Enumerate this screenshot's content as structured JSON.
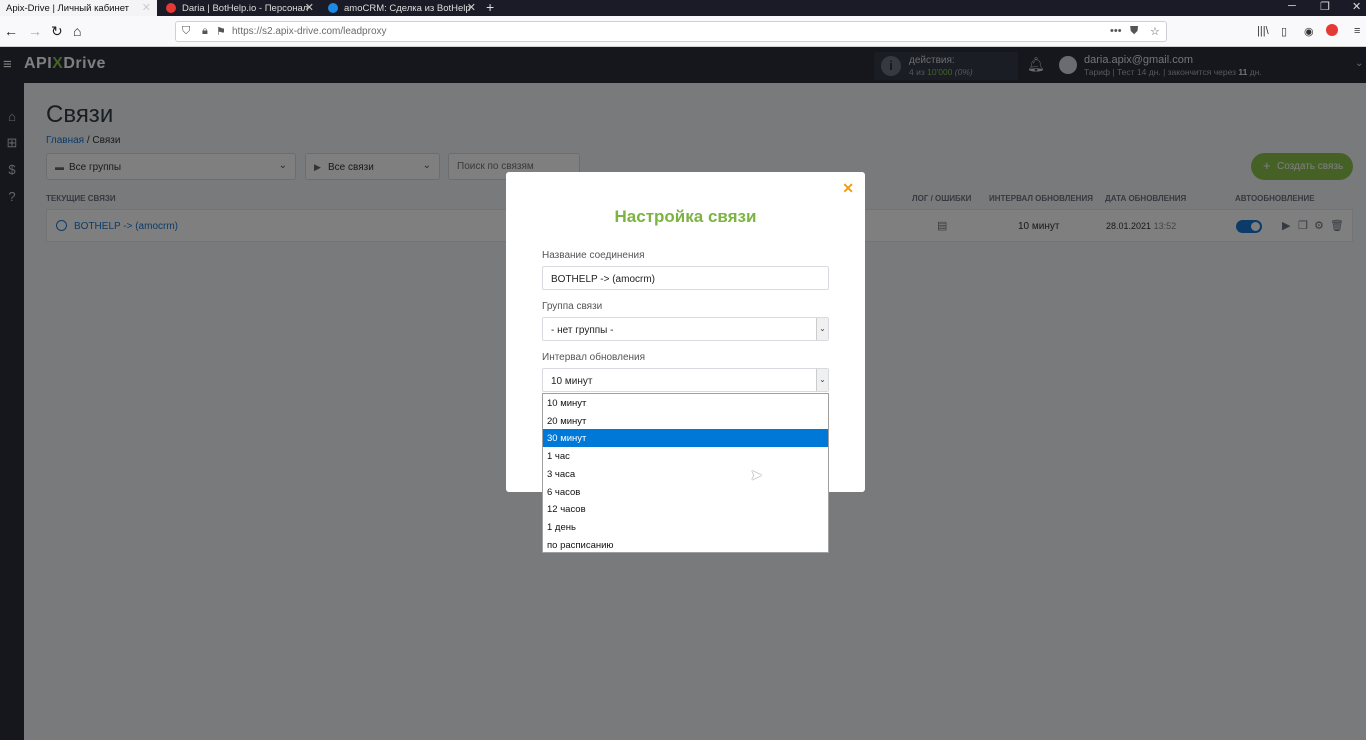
{
  "browser": {
    "tabs": [
      {
        "label": "Apix-Drive | Личный кабинет",
        "active": true
      },
      {
        "label": "Daria | BotHelp.io - Персонал",
        "active": false
      },
      {
        "label": "amoCRM: Сделка из BotHelp",
        "active": false
      }
    ],
    "url": "https://s2.apix-drive.com/leadproxy"
  },
  "header": {
    "logo_left": "API",
    "logo_x": "X",
    "logo_right": "Drive",
    "actions_label": "действия:",
    "actions_used": "4",
    "actions_of": "из",
    "actions_total": "10'000",
    "actions_pct": "(0%)",
    "user_email": "daria.apix@gmail.com",
    "plan_prefix": "Тариф | Тест 14 дн. | закончится через",
    "plan_days": "11",
    "plan_suffix": "дн."
  },
  "page": {
    "title": "Связи",
    "breadcrumb_home": "Главная",
    "breadcrumb_sep": "/",
    "breadcrumb_current": "Связи",
    "filter_groups": "Все группы",
    "filter_links": "Все связи",
    "search_placeholder": "Поиск по связям",
    "create_button": "Создать связь"
  },
  "table": {
    "col_current": "ТЕКУЩИЕ СВЯЗИ",
    "col_log": "ЛОГ / ОШИБКИ",
    "col_interval": "ИНТЕРВАЛ ОБНОВЛЕНИЯ",
    "col_date": "ДАТА ОБНОВЛЕНИЯ",
    "col_auto": "АВТООБНОВЛЕНИЕ",
    "row": {
      "name": "BOTHELP -> (amocrm)",
      "interval": "10 минут",
      "date": "28.01.2021",
      "time": "13:52"
    }
  },
  "modal": {
    "title": "Настройка связи",
    "name_label": "Название соединения",
    "name_value": "BOTHELP -> (amocrm)",
    "group_label": "Группа связи",
    "group_value": "- нет группы -",
    "interval_label": "Интервал обновления",
    "interval_value": "10 минут",
    "interval_options": [
      "10 минут",
      "20 минут",
      "30 минут",
      "1 час",
      "3 часа",
      "6 часов",
      "12 часов",
      "1 день",
      "по расписанию"
    ],
    "highlighted_option_index": 2
  }
}
